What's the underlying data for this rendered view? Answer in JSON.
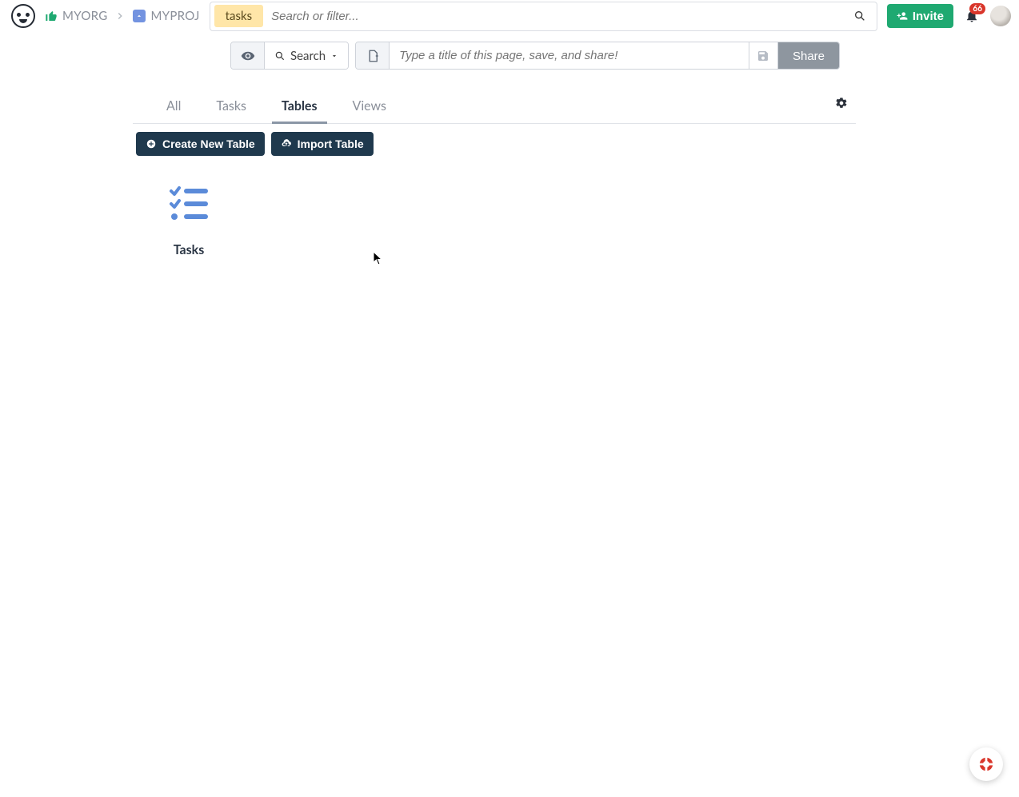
{
  "breadcrumb": {
    "org": "MYORG",
    "project": "MYPROJ"
  },
  "search": {
    "tag": "tasks",
    "placeholder": "Search or filter..."
  },
  "header": {
    "invite_label": "Invite",
    "notification_count": "66"
  },
  "toolbar": {
    "search_label": "Search",
    "title_placeholder": "Type a title of this page, save, and share!",
    "share_label": "Share"
  },
  "tabs": {
    "items": [
      {
        "label": "All",
        "active": false
      },
      {
        "label": "Tasks",
        "active": false
      },
      {
        "label": "Tables",
        "active": true
      },
      {
        "label": "Views",
        "active": false
      }
    ]
  },
  "actions": {
    "create_label": "Create New Table",
    "import_label": "Import Table"
  },
  "cards": [
    {
      "title": "Tasks"
    }
  ]
}
